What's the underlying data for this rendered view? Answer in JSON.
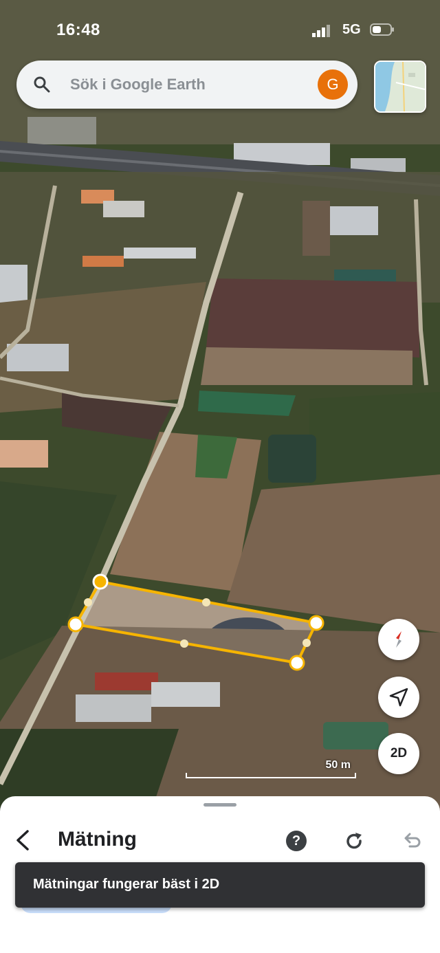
{
  "status_bar": {
    "time": "16:48",
    "network": "5G"
  },
  "search": {
    "placeholder": "Sök i Google Earth",
    "avatar_letter": "G"
  },
  "map": {
    "scale_label": "50 m",
    "view_mode_label": "2D",
    "accent": "#f6b400"
  },
  "icons": {
    "search": "search-icon",
    "compass": "compass-icon",
    "locate": "navigation-arrow-icon",
    "back": "chevron-left-icon",
    "help": "help-icon",
    "redo": "redo-icon",
    "undo": "undo-icon"
  },
  "measure_panel": {
    "title": "Mätning",
    "help_glyph": "?"
  },
  "toast": {
    "text": "Mätningar fungerar bäst i 2D"
  }
}
